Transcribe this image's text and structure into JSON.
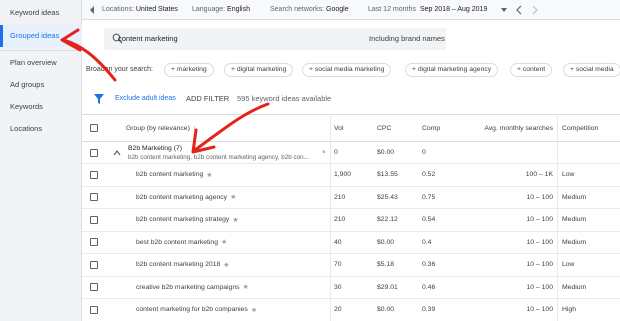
{
  "sidebar": {
    "items": [
      {
        "label": "Keyword ideas"
      },
      {
        "label": "Grouped ideas"
      },
      {
        "label": "Plan overview"
      },
      {
        "label": "Ad groups"
      },
      {
        "label": "Keywords"
      },
      {
        "label": "Locations"
      }
    ]
  },
  "topbar": {
    "locations_label": "Locations:",
    "locations_value": "United States",
    "language_label": "Language:",
    "language_value": "English",
    "networks_label": "Search networks:",
    "networks_value": "Google",
    "period_label": "Last 12 months",
    "period_value": "Sep 2018 – Aug 2019"
  },
  "search": {
    "value": "content marketing",
    "brand_label": "Including brand names"
  },
  "broaden": {
    "label": "Broaden your search:",
    "chips": [
      "marketing",
      "digital marketing",
      "social media marketing",
      "digital marketing agency",
      "content",
      "social media"
    ]
  },
  "filter": {
    "exclude_label": "Exclude adult ideas",
    "add_filter_label": "ADD FILTER",
    "count_text": "595 keyword ideas available"
  },
  "table": {
    "headers": {
      "group": "Group (by relevance)",
      "vol": "Vol",
      "cpc": "CPC",
      "comp": "Comp",
      "avg": "Avg. monthly searches",
      "competition": "Competition"
    },
    "group_row": {
      "title": "B2b Marketing (7)",
      "subtitle": "b2b content marketing, b2b content marketing agency, b2b con...",
      "vol": "0",
      "cpc": "$0.00",
      "comp": "0"
    },
    "rows": [
      {
        "keyword": "b2b content marketing",
        "vol": "1,900",
        "cpc": "$13.55",
        "comp": "0.52",
        "avg": "100 – 1K",
        "competition": "Low"
      },
      {
        "keyword": "b2b content marketing agency",
        "vol": "210",
        "cpc": "$25.43",
        "comp": "0.75",
        "avg": "10 – 100",
        "competition": "Medium"
      },
      {
        "keyword": "b2b content marketing strategy",
        "vol": "210",
        "cpc": "$22.12",
        "comp": "0.54",
        "avg": "10 – 100",
        "competition": "Medium"
      },
      {
        "keyword": "best b2b content marketing",
        "vol": "40",
        "cpc": "$0.00",
        "comp": "0.4",
        "avg": "10 – 100",
        "competition": "Medium"
      },
      {
        "keyword": "b2b content marketing 2018",
        "vol": "70",
        "cpc": "$5.18",
        "comp": "0.36",
        "avg": "10 – 100",
        "competition": "Low"
      },
      {
        "keyword": "creative b2b marketing campaigns",
        "vol": "30",
        "cpc": "$29.01",
        "comp": "0.46",
        "avg": "10 – 100",
        "competition": "Medium"
      },
      {
        "keyword": "content marketing for b2b companies",
        "vol": "20",
        "cpc": "$0.00",
        "comp": "0.39",
        "avg": "10 – 100",
        "competition": "High"
      }
    ]
  },
  "colors": {
    "accent": "#1a73e8",
    "annotation": "#e5231b"
  }
}
